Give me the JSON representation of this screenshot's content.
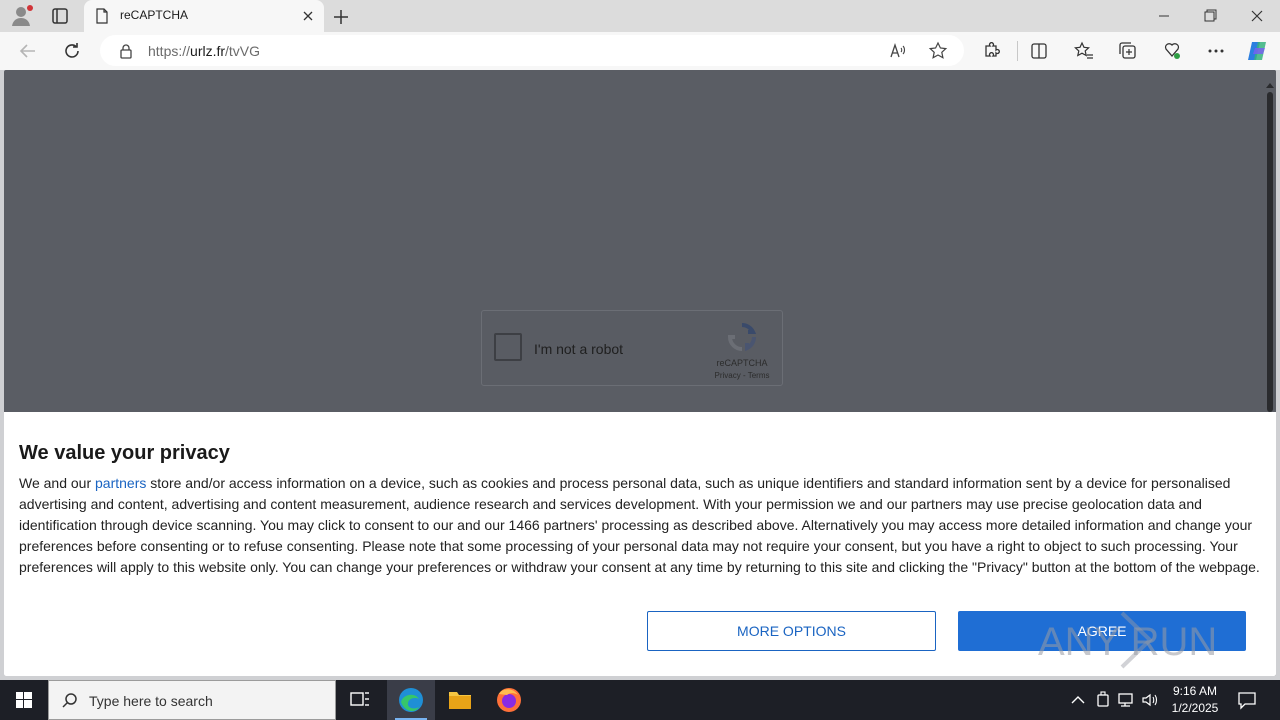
{
  "browser": {
    "tab_title": "reCAPTCHA",
    "url_prefix": "https://",
    "url_domain": "urlz.fr",
    "url_path": "/tvVG"
  },
  "captcha": {
    "checkbox_label": "I'm not a robot",
    "brand": "reCAPTCHA",
    "links": "Privacy - Terms"
  },
  "consent": {
    "title": "We value your privacy",
    "text_before_link": "We and our ",
    "link": "partners",
    "text_after_link": " store and/or access information on a device, such as cookies and process personal data, such as unique identifiers and standard information sent by a device for personalised advertising and content, advertising and content measurement, audience research and services development. With your permission we and our partners may use precise geolocation data and identification through device scanning. You may click to consent to our and our 1466 partners' processing as described above. Alternatively you may access more detailed information and change your preferences before consenting or to refuse consenting. Please note that some processing of your personal data may not require your consent, but you have a right to object to such processing. Your preferences will apply to this website only. You can change your preferences or withdraw your consent at any time by returning to this site and clicking the \"Privacy\" button at the bottom of the webpage.",
    "more_options": "MORE OPTIONS",
    "agree": "AGREE"
  },
  "watermark": "ANY RUN",
  "taskbar": {
    "search_placeholder": "Type here to search",
    "time": "9:16 AM",
    "date": "1/2/2025"
  },
  "colors": {
    "accent": "#1f6ed4",
    "overlay": "#5a5d64",
    "taskbar": "#1d1f26"
  }
}
